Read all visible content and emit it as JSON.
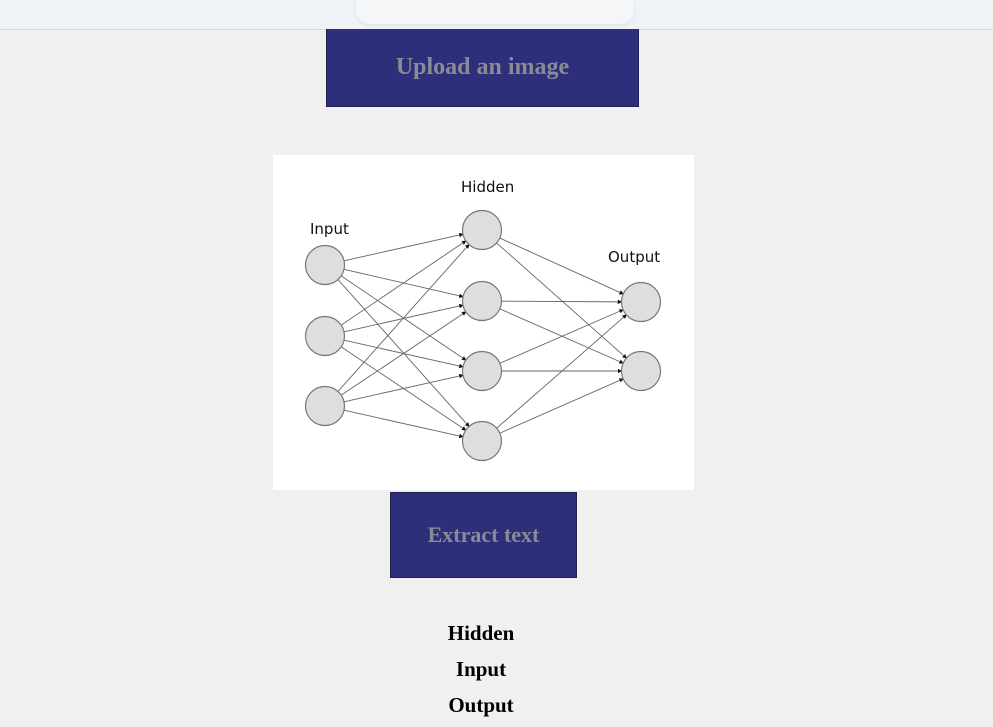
{
  "upload_button": {
    "label": "Upload an image"
  },
  "diagram": {
    "labels": {
      "hidden": "Hidden",
      "input": "Input",
      "output": "Output"
    },
    "layers": [
      {
        "name": "input",
        "nodes": 3
      },
      {
        "name": "hidden",
        "nodes": 4
      },
      {
        "name": "output",
        "nodes": 2
      }
    ]
  },
  "extract_button": {
    "label": "Extract text"
  },
  "results": [
    "Hidden",
    "Input",
    "Output"
  ]
}
